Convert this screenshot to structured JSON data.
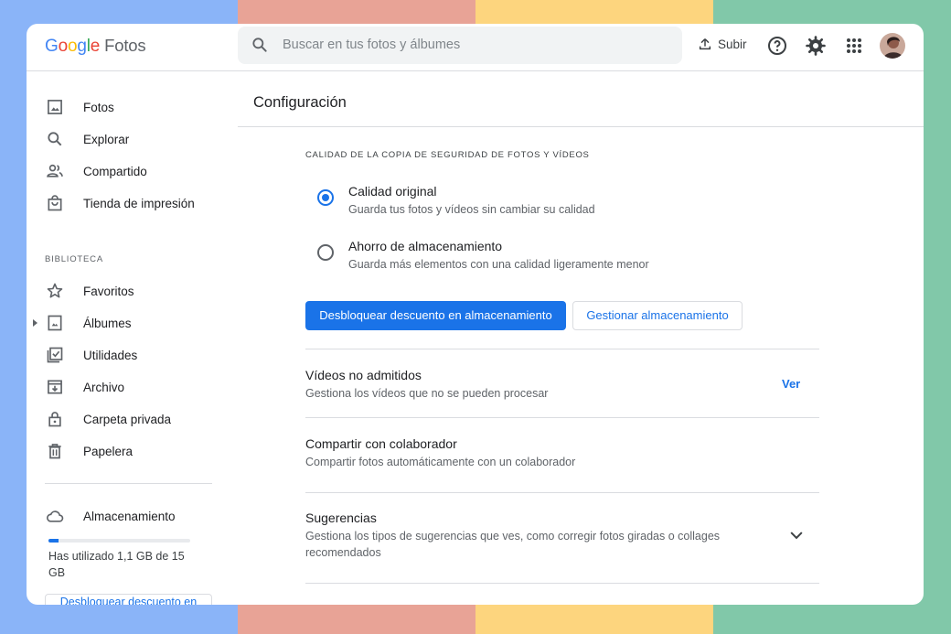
{
  "colors": {
    "accent": "#1a73e8",
    "stripes": [
      "#8ab4f8",
      "#e8a396",
      "#fdd57e",
      "#81c8a9"
    ]
  },
  "header": {
    "logo_letters": [
      "G",
      "o",
      "o",
      "g",
      "l",
      "e"
    ],
    "logo_colors": [
      "#4285f4",
      "#ea4335",
      "#fbbc05",
      "#4285f4",
      "#34a853",
      "#ea4335"
    ],
    "product": "Fotos",
    "search_placeholder": "Buscar en tus fotos y álbumes",
    "upload_label": "Subir",
    "icons": [
      "search-icon",
      "upload-icon",
      "help-icon",
      "gear-icon",
      "apps-grid-icon",
      "avatar"
    ]
  },
  "sidebar": {
    "items": [
      {
        "label": "Fotos",
        "icon": "photo-icon"
      },
      {
        "label": "Explorar",
        "icon": "search-icon"
      },
      {
        "label": "Compartido",
        "icon": "people-icon"
      },
      {
        "label": "Tienda de impresión",
        "icon": "shopping-bag-icon"
      }
    ],
    "library_label": "BIBLIOTECA",
    "library_items": [
      {
        "label": "Favoritos",
        "icon": "star-icon"
      },
      {
        "label": "Álbumes",
        "icon": "album-icon"
      },
      {
        "label": "Utilidades",
        "icon": "utilities-icon"
      },
      {
        "label": "Archivo",
        "icon": "archive-icon"
      },
      {
        "label": "Carpeta privada",
        "icon": "lock-icon"
      },
      {
        "label": "Papelera",
        "icon": "trash-icon"
      }
    ],
    "storage_label": "Almacenamiento",
    "storage_used_fraction": 0.073,
    "storage_text": "Has utilizado 1,1 GB de 15 GB",
    "unlock_button": "Desbloquear descuento en almacenamiento"
  },
  "main": {
    "title": "Configuración",
    "backup_caption": "CALIDAD DE LA COPIA DE SEGURIDAD DE FOTOS Y VÍDEOS",
    "options": [
      {
        "title": "Calidad original",
        "sub": "Guarda tus fotos y vídeos sin cambiar su calidad",
        "selected": true
      },
      {
        "title": "Ahorro de almacenamiento",
        "sub": "Guarda más elementos con una calidad ligeramente menor",
        "selected": false
      }
    ],
    "primary_button": "Desbloquear descuento en almacenamiento",
    "secondary_button": "Gestionar almacenamiento",
    "rows": [
      {
        "title": "Vídeos no admitidos",
        "sub": "Gestiona los vídeos que no se pueden procesar",
        "action": "Ver"
      },
      {
        "title": "Compartir con colaborador",
        "sub": "Compartir fotos automáticamente con un colaborador"
      },
      {
        "title": "Sugerencias",
        "sub": "Gestiona los tipos de sugerencias que ves, como corregir fotos giradas o collages recomendados"
      }
    ]
  }
}
